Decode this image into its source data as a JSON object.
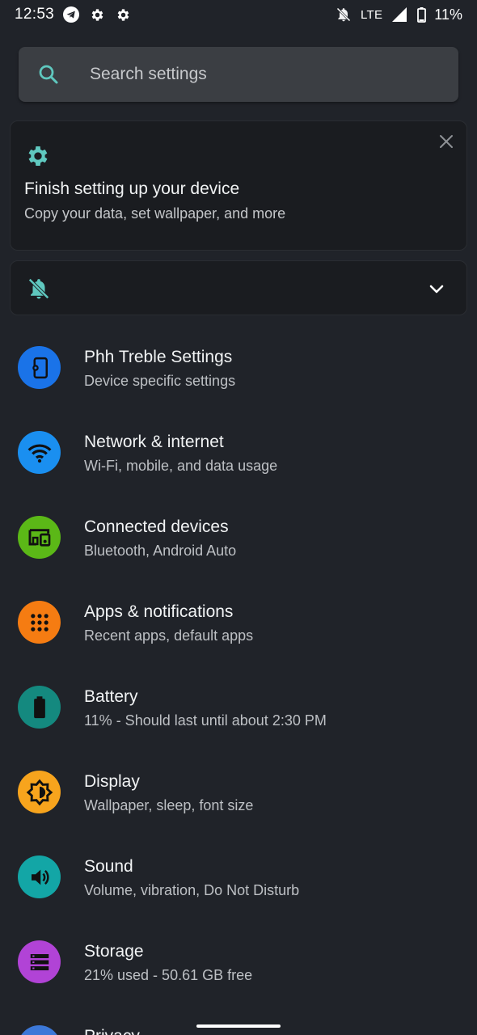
{
  "status_bar": {
    "time": "12:53",
    "left_icons": [
      "telegram-icon",
      "gear-icon",
      "gear-icon"
    ],
    "network": "LTE",
    "battery": "11%"
  },
  "search": {
    "placeholder": "Search settings"
  },
  "suggestion_card": {
    "title": "Finish setting up your device",
    "subtitle": "Copy your data, set wallpaper, and more"
  },
  "condition": {
    "icon": "notifications-off-icon"
  },
  "settings": [
    {
      "title": "Phh Treble Settings",
      "subtitle": "Device specific settings",
      "icon": "phone-settings-icon",
      "color": "#1a73e8"
    },
    {
      "title": "Network & internet",
      "subtitle": "Wi-Fi, mobile, and data usage",
      "icon": "wifi-icon",
      "color": "#1a8ff0"
    },
    {
      "title": "Connected devices",
      "subtitle": "Bluetooth, Android Auto",
      "icon": "devices-icon",
      "color": "#5bb817"
    },
    {
      "title": "Apps & notifications",
      "subtitle": "Recent apps, default apps",
      "icon": "apps-icon",
      "color": "#f57c12"
    },
    {
      "title": "Battery",
      "subtitle": "11% - Should last until about 2:30 PM",
      "icon": "battery-icon",
      "color": "#14897f"
    },
    {
      "title": "Display",
      "subtitle": "Wallpaper, sleep, font size",
      "icon": "brightness-icon",
      "color": "#f7a41d"
    },
    {
      "title": "Sound",
      "subtitle": "Volume, vibration, Do Not Disturb",
      "icon": "volume-icon",
      "color": "#13a6a6"
    },
    {
      "title": "Storage",
      "subtitle": "21% used - 50.61 GB free",
      "icon": "storage-icon",
      "color": "#b143d6"
    },
    {
      "title": "Privacy",
      "subtitle": "",
      "icon": "privacy-icon",
      "color": "#3c78d8"
    }
  ],
  "colors": {
    "background": "#202329",
    "accent": "#5fc8bf"
  }
}
